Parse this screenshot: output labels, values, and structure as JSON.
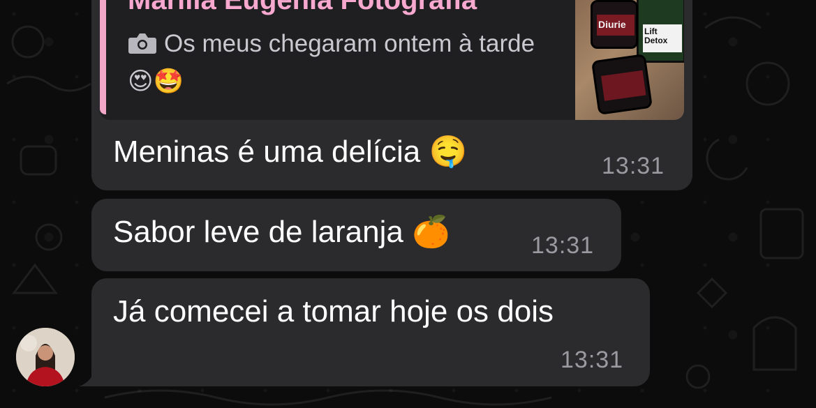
{
  "quoted_message": {
    "author": "Marilia Eugenia Fotografia",
    "icon": "camera-icon",
    "text": "Os meus chegaram ontem à tarde 😍🤩",
    "thumbnail_labels": [
      "Diurie",
      "Lift Detox"
    ]
  },
  "messages": [
    {
      "text": "Meninas é uma delícia 🤤",
      "time": "13:31"
    },
    {
      "text": "Sabor leve de laranja 🍊",
      "time": "13:31"
    },
    {
      "text": "Já comecei a tomar hoje os dois",
      "time": "13:31"
    }
  ],
  "colors": {
    "bubble": "#2b2b2e",
    "quote_accent": "#f3a7c8",
    "author": "#f7a8cf",
    "timestamp": "#9a9aa0"
  }
}
